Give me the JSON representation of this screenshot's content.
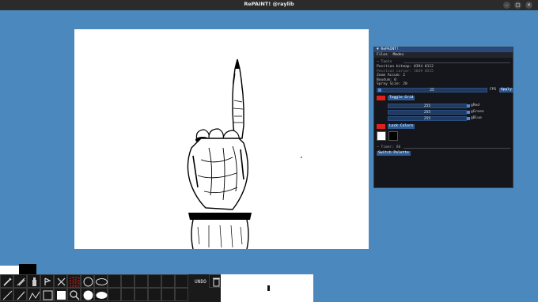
{
  "window": {
    "title": "RePAINT! @raylib",
    "buttons": [
      "–",
      "□",
      "✕"
    ]
  },
  "panel": {
    "title": "RePAINT!",
    "menu": [
      "Files",
      "Modes"
    ],
    "tools_section": "Tools",
    "lines": [
      "Position bitmap: 0394 0112",
      "Position cursor: 1049 0515",
      "Zoom Accum: 2",
      "Boudum: 0",
      "Spray Size: 20"
    ],
    "fps_value": "25",
    "fps_label": "FPS",
    "apply_label": "Apply",
    "toggle_grid_label": "Toggle Grid",
    "red": {
      "value": "255",
      "label": "gRed"
    },
    "green": {
      "value": "255",
      "label": "gGreen"
    },
    "blue": {
      "value": "255",
      "label": "gBlue"
    },
    "lock_colors_label": "Lock Colors",
    "timer_section": "Timer: 86",
    "switch_palette_label": "Switch Palette"
  },
  "toolbar": {
    "undo_label": "UNDO"
  },
  "colors": {
    "primary": "#ffffff",
    "secondary": "#000000",
    "accent_red": "#e0201c",
    "background": "#4a88be"
  }
}
